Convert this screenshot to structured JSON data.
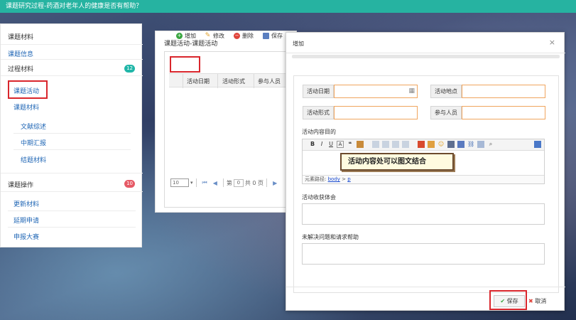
{
  "header": {
    "title": "课题研究过程-药酒对老年人的健康是否有帮助？"
  },
  "sidebar": {
    "title": "课题材料",
    "items": [
      {
        "label": "课题信息"
      },
      {
        "label": "过程材料",
        "badge": "12"
      },
      {
        "label": "课题活动"
      },
      {
        "label": "课题材料"
      },
      {
        "label": "文献综述"
      },
      {
        "label": "中期汇报"
      },
      {
        "label": "结题材料"
      },
      {
        "label": "课题操作",
        "badge": "10"
      },
      {
        "label": "更新材料"
      },
      {
        "label": "延期申请"
      },
      {
        "label": "申报大赛"
      }
    ]
  },
  "panel": {
    "title": "课题活动-课题活动",
    "toolbar": {
      "add": "增加",
      "edit": "修改",
      "delete": "删除",
      "save": "保存"
    },
    "columns": [
      "活动日期",
      "活动形式",
      "参与人员"
    ],
    "pager": {
      "page_size": "10",
      "page_prefix": "第",
      "page_value": "0",
      "page_total": "共 0 页"
    }
  },
  "modal": {
    "title": "增加",
    "close": "×",
    "fields": {
      "date": "活动日期",
      "location": "活动地点",
      "form": "活动形式",
      "participants": "参与人员"
    },
    "content_label": "活动内容目的",
    "editor_path_label": "元素路径:",
    "editor_path_body": "body",
    "editor_path_gt": ">",
    "editor_path_p": "p",
    "gains_label": "活动收获体会",
    "problems_label": "未解决问题和请求帮助",
    "save": "保存",
    "cancel": "取消"
  },
  "callout": {
    "text": "活动内容处可以图文结合"
  },
  "colors": {
    "header_bg": "#26b3a1",
    "badge_teal": "#20b6a8",
    "badge_red": "#e65a66",
    "highlight": "#d9262c",
    "input_border": "#f0a55e"
  }
}
